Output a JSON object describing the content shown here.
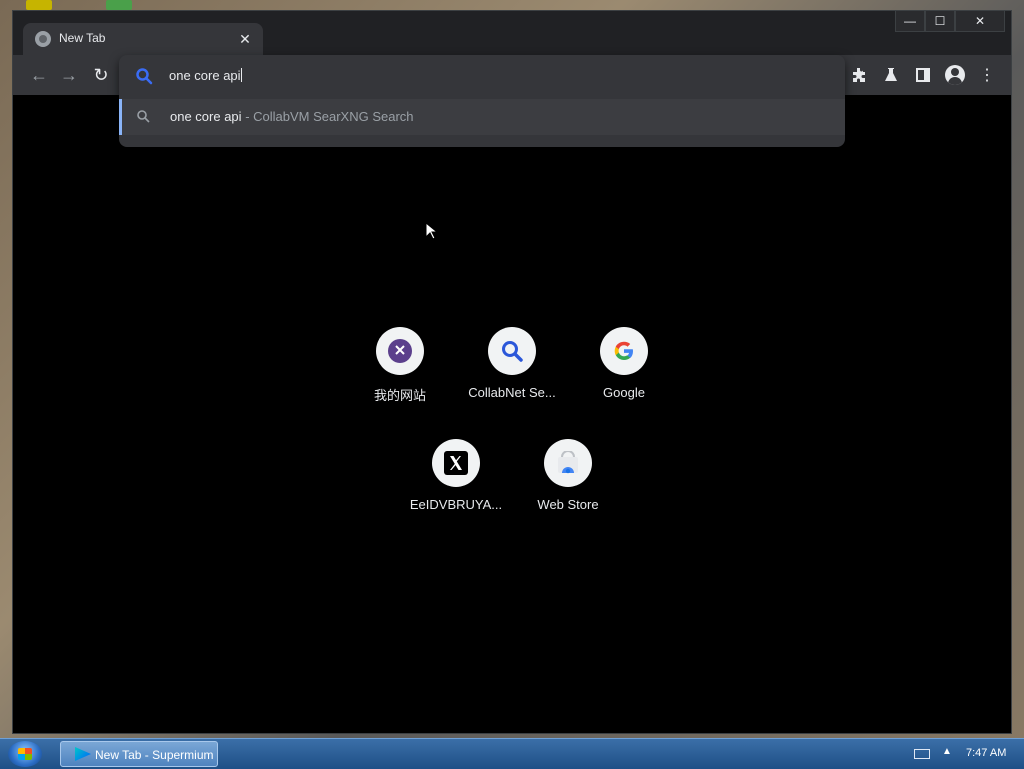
{
  "tab": {
    "title": "New Tab",
    "close_glyph": "✕"
  },
  "window_controls": {
    "minimize": "—",
    "maximize": "☐",
    "close": "✕"
  },
  "omnibox": {
    "query": "one core api",
    "suggestion": {
      "query": "one core api",
      "source": "- CollabVM SearXNG Search"
    }
  },
  "shortcuts": [
    {
      "label": "我的网站",
      "icon": "purple-x-icon"
    },
    {
      "label": "CollabNet Se...",
      "icon": "search-magnifier-icon"
    },
    {
      "label": "Google",
      "icon": "google-g-icon"
    },
    {
      "label": "EeIDVBRUYA...",
      "icon": "x-logo-icon"
    },
    {
      "label": "Web Store",
      "icon": "web-store-icon"
    }
  ],
  "taskbar": {
    "active_item": "New Tab - Supermium",
    "clock": "7:47 AM"
  },
  "colors": {
    "accent": "#8ab4f8",
    "toolbar": "#35363a",
    "content_bg": "#000000"
  }
}
